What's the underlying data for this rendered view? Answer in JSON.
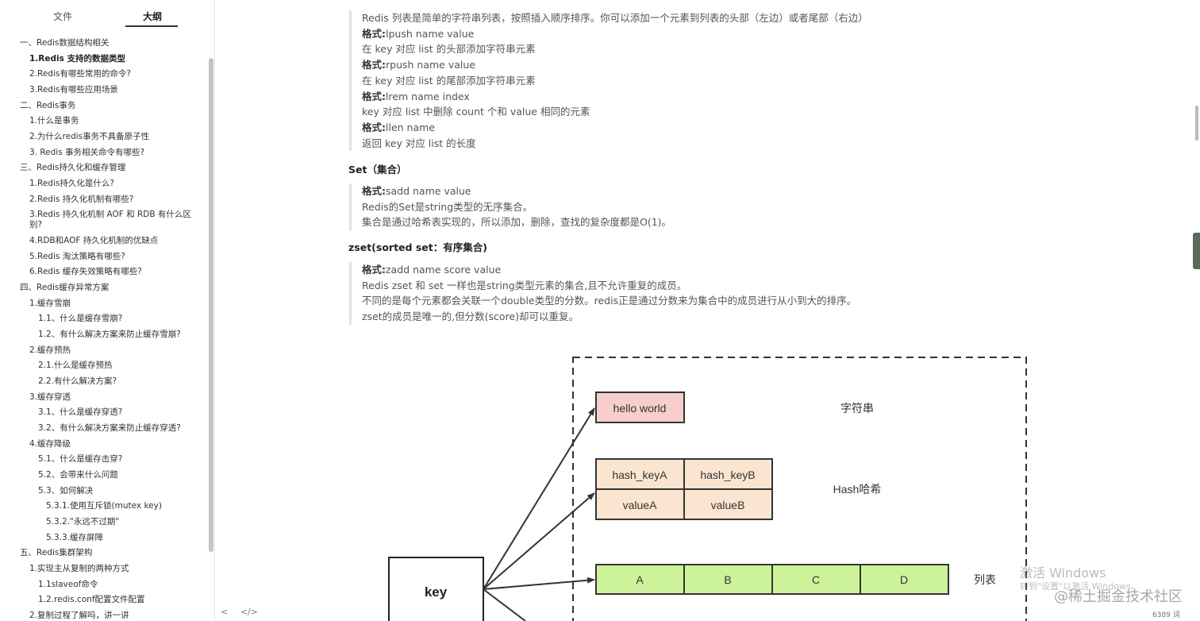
{
  "sidebar": {
    "tabs": {
      "files": "文件",
      "outline": "大纲"
    },
    "items": [
      "一、Redis数据结构相关",
      "1.Redis 支持的数据类型",
      "2.Redis有哪些常用的命令?",
      "3.Redis有哪些应用场景",
      "二、Redis事务",
      "1.什么是事务",
      "2.为什么redis事务不具备原子性",
      "3. Redis 事务相关命令有哪些?",
      "三、Redis持久化和缓存管理",
      "1.Redis持久化是什么?",
      "2.Redis 持久化机制有哪些?",
      "3.Redis 持久化机制 AOF 和 RDB 有什么区别?",
      "4.RDB和AOF 持久化机制的优缺点",
      "5.Redis 淘汰策略有哪些?",
      "6.Redis 缓存失效策略有哪些?",
      "四、Redis缓存异常方案",
      "1.缓存雪崩",
      "1.1、什么是缓存雪崩?",
      "1.2、有什么解决方案来防止缓存雪崩?",
      "2.缓存预热",
      "2.1.什么是缓存预热",
      "2.2.有什么解决方案?",
      "3.缓存穿透",
      "3.1、什么是缓存穿透?",
      "3.2、有什么解决方案来防止缓存穿透?",
      "4.缓存降级",
      "5.1、什么是缓存击穿?",
      "5.2、会带来什么问题",
      "5.3、如何解决",
      "5.3.1.使用互斥锁(mutex key)",
      "5.3.2.\"永远不过期\"",
      "5.3.3.缓存屏障",
      "五、Redis集群架构",
      "1.实现主从复制的两种方式",
      "1.1slaveof命令",
      "1.2.redis.conf配置文件配置",
      "2.复制过程了解吗，讲一讲"
    ]
  },
  "footer": {
    "back": "<",
    "source": "</>",
    "word_count": "6389 词"
  },
  "content": {
    "list_block": {
      "intro": "Redis 列表是简单的字符串列表，按照插入顺序排序。你可以添加一个元素到列表的头部（左边）或者尾部（右边）",
      "format_label": "格式:",
      "cmd1": "lpush  name  value",
      "desc1": "在 key 对应 list 的头部添加字符串元素",
      "cmd2": "rpush  name  value",
      "desc2": "在 key 对应 list 的尾部添加字符串元素",
      "cmd3": "lrem name  index",
      "desc3": "key 对应 list 中删除 count 个和 value 相同的元素",
      "cmd4": "llen name",
      "desc4": "返回 key 对应 list 的长度"
    },
    "set_heading": "Set（集合）",
    "set_block": {
      "cmd": "sadd  name  value",
      "line1": "Redis的Set是string类型的无序集合。",
      "line2": "集合是通过哈希表实现的，所以添加，删除，查找的复杂度都是O(1)。"
    },
    "zset_heading": "zset(sorted set：有序集合)",
    "zset_block": {
      "cmd": "zadd  name score value",
      "line1": "Redis zset 和 set 一样也是string类型元素的集合,且不允许重复的成员。",
      "line2": "不同的是每个元素都会关联一个double类型的分数。redis正是通过分数来为集合中的成员进行从小到大的排序。",
      "line3": "zset的成员是唯一的,但分数(score)却可以重复。"
    }
  },
  "diagram": {
    "key": "key",
    "string_value": "hello world",
    "string_label": "字符串",
    "hash_keyA": "hash_keyA",
    "hash_keyB": "hash_keyB",
    "valueA": "valueA",
    "valueB": "valueB",
    "hash_label": "Hash哈希",
    "list_items": [
      "A",
      "B",
      "C",
      "D"
    ],
    "list_label": "列表",
    "colors": {
      "string": "#f8cecc",
      "hash": "#fbe5d0",
      "list": "#cdf39a"
    }
  },
  "watermark": {
    "activate_title": "激活 Windows",
    "activate_sub": "转到\"设置\"以激活 Windows。",
    "site": "@稀土掘金技术社区"
  }
}
